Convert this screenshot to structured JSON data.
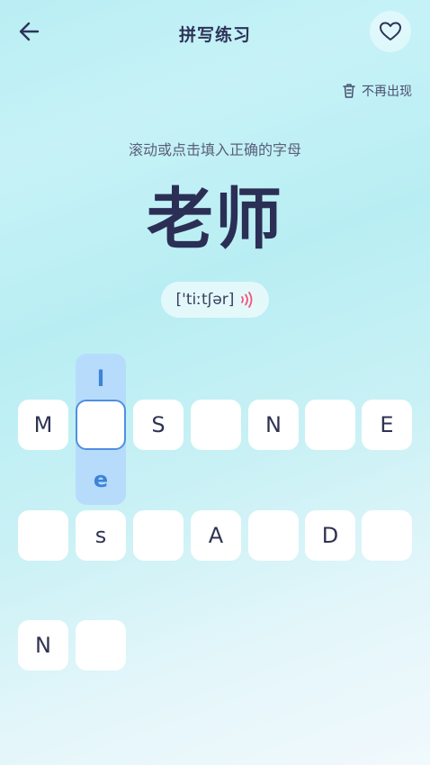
{
  "header": {
    "title": "拼写练习",
    "back_icon": "arrow-left-icon",
    "favorite_icon": "heart-icon"
  },
  "hide_action": {
    "label": "不再出现",
    "icon": "trash-icon"
  },
  "instruction": "滚动或点击填入正确的字母",
  "word": "老师",
  "phonetic": {
    "text": "['tiːtʃər]",
    "icon": "sound-wave-icon",
    "icon_color": "#f0557a"
  },
  "picker": {
    "above": "l",
    "below": "e"
  },
  "grid": {
    "row1": [
      "M",
      "",
      "S",
      "",
      "N",
      "",
      "E"
    ],
    "row2": [
      "",
      "s",
      "",
      "A",
      "",
      "D",
      ""
    ],
    "row3": [
      "N",
      ""
    ]
  },
  "colors": {
    "picker_bg": "#b7dcfb",
    "picker_text": "#3d83d8",
    "active_border": "#4f8ee3"
  }
}
